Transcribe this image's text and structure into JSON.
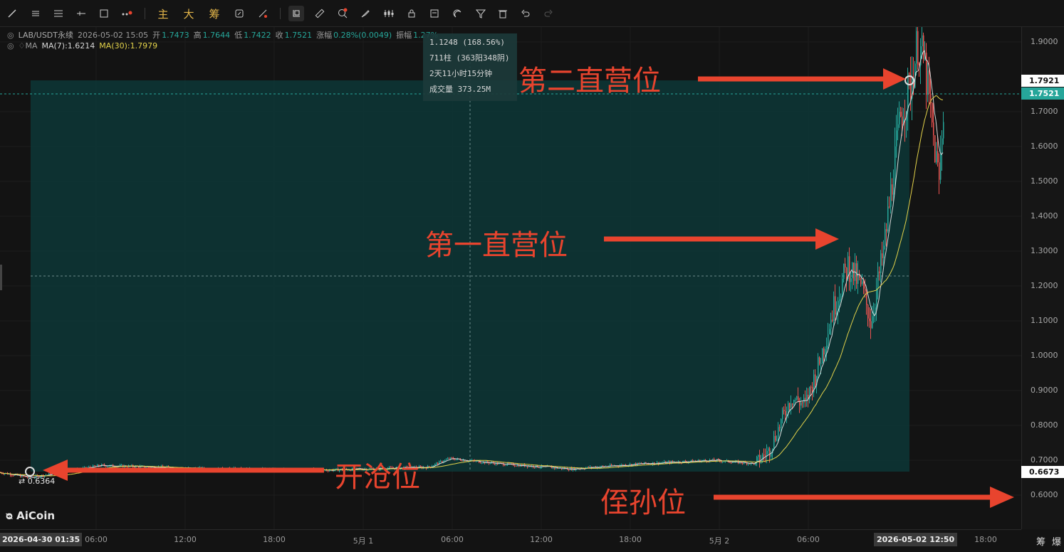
{
  "toolbar": {
    "cn_buttons": [
      "主",
      "大",
      "筹"
    ]
  },
  "legend": {
    "symbol": "LAB/USDT永续",
    "datetime": "2026-05-02 15:05",
    "open_label": "开",
    "open": "1.7473",
    "high_label": "高",
    "high": "1.7644",
    "low_label": "低",
    "low": "1.7422",
    "close_label": "收",
    "close": "1.7521",
    "change_label": "涨幅",
    "change": "0.28%(0.0049)",
    "amp_label": "振幅",
    "amp": "1.27%",
    "ma_title": "MA",
    "ma7": "MA(7):1.6214",
    "ma30": "MA(30):1.7979"
  },
  "measure": {
    "line1": "1.1248 (168.56%)",
    "line2": "711柱 (363阳348阴)",
    "line3": "2天11小时15分钟",
    "line4": "成交量 373.25M"
  },
  "annotations": {
    "second": "第二直营位",
    "first": "第一直营位",
    "open": "开沧位",
    "nephew": "侄孙位"
  },
  "start_price": "0.6364",
  "logo": "AiCoin",
  "price_axis": {
    "labels": [
      "1.9000",
      "1.7000",
      "1.6000",
      "1.5000",
      "1.4000",
      "1.3000",
      "1.2000",
      "1.1000",
      "1.0000",
      "0.9000",
      "0.8000",
      "0.7000",
      "0.6000"
    ],
    "tag_upper": "1.7921",
    "tag_current": "1.7521",
    "tag_lower": "0.6673"
  },
  "time_axis": {
    "start": "2026-04-30 01:35",
    "labels": [
      "06:00",
      "12:00",
      "18:00",
      "5月 1",
      "06:00",
      "12:00",
      "18:00",
      "5月 2",
      "06:00"
    ],
    "cursor": "2026-05-02 12:50",
    "end_label": "18:00",
    "corner": [
      "筹",
      "爆"
    ]
  },
  "colors": {
    "up": "#26a69a",
    "down": "#ef5350",
    "ma7": "#d8d8d8",
    "ma30": "#e3d24a",
    "annotation": "#e8442e",
    "box": "#0c3a3a"
  }
}
